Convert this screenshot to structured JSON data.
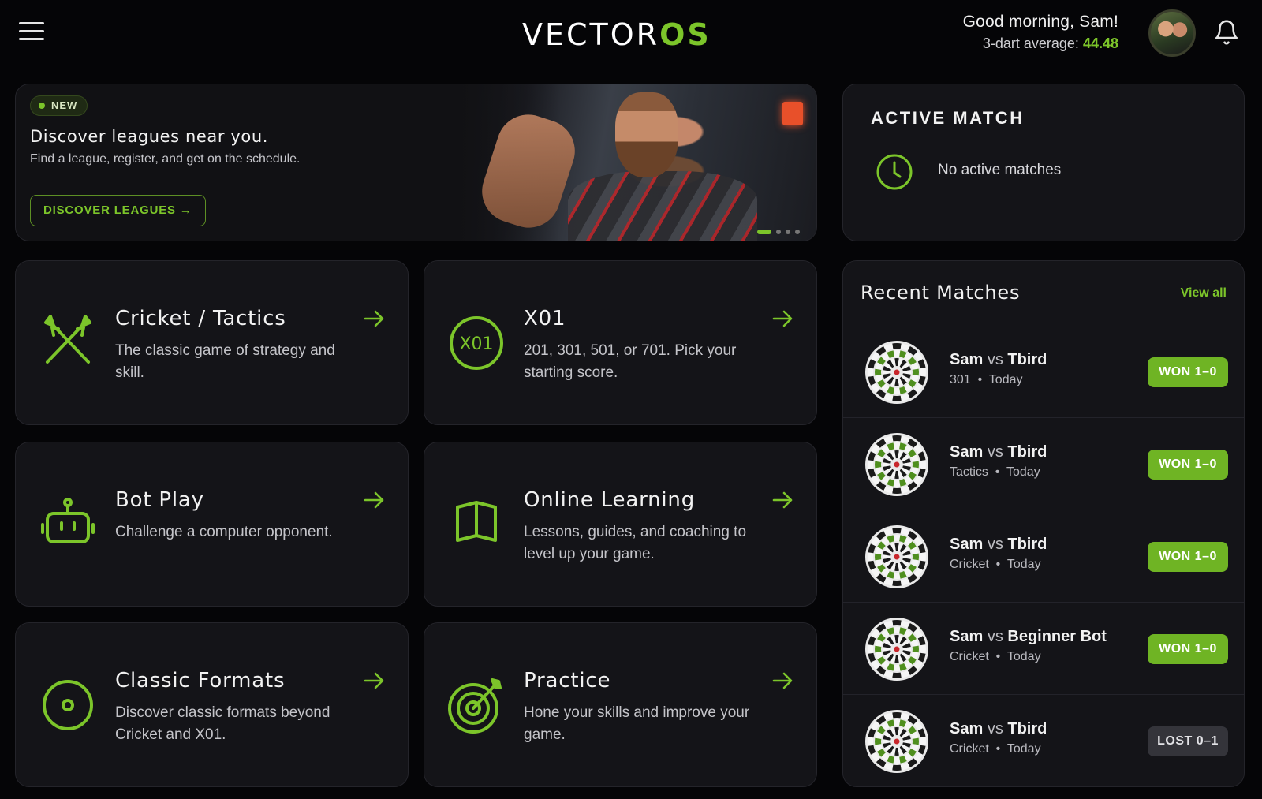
{
  "header": {
    "logo_left": "VECTOR",
    "logo_right": "OS",
    "greeting": "Good morning, Sam!",
    "avg_label": "3-dart average:",
    "avg_value": "44.48"
  },
  "hero": {
    "badge": "NEW",
    "title": "Discover leagues near you.",
    "subtitle": "Find a league, register, and get on the schedule.",
    "button": "DISCOVER LEAGUES →"
  },
  "active_match": {
    "title": "ACTIVE MATCH",
    "empty_text": "No active matches"
  },
  "tiles": [
    {
      "title": "Cricket / Tactics",
      "desc": "The classic game of strategy and skill.",
      "icon": "crossed-darts-icon"
    },
    {
      "title": "X01",
      "desc": "201, 301, 501, or 701. Pick your starting score.",
      "icon": "x01-icon",
      "icon_text": "X01"
    },
    {
      "title": "Bot Play",
      "desc": "Challenge a computer opponent.",
      "icon": "robot-icon"
    },
    {
      "title": "Online Learning",
      "desc": "Lessons, guides, and coaching to level up your game.",
      "icon": "book-icon"
    },
    {
      "title": "Classic Formats",
      "desc": "Discover classic formats beyond Cricket and X01.",
      "icon": "target-circle-icon"
    },
    {
      "title": "Practice",
      "desc": "Hone your skills and improve your game.",
      "icon": "dartboard-arrow-icon"
    }
  ],
  "recent": {
    "title": "Recent Matches",
    "view_all": "View all",
    "matches": [
      {
        "player": "Sam",
        "vs": "vs",
        "opponent": "Tbird",
        "format": "301",
        "when": "Today",
        "result": "WON 1–0",
        "won": true
      },
      {
        "player": "Sam",
        "vs": "vs",
        "opponent": "Tbird",
        "format": "Tactics",
        "when": "Today",
        "result": "WON 1–0",
        "won": true
      },
      {
        "player": "Sam",
        "vs": "vs",
        "opponent": "Tbird",
        "format": "Cricket",
        "when": "Today",
        "result": "WON 1–0",
        "won": true
      },
      {
        "player": "Sam",
        "vs": "vs",
        "opponent": "Beginner Bot",
        "format": "Cricket",
        "when": "Today",
        "result": "WON 1–0",
        "won": true
      },
      {
        "player": "Sam",
        "vs": "vs",
        "opponent": "Tbird",
        "format": "Cricket",
        "when": "Today",
        "result": "LOST 0–1",
        "won": false
      }
    ]
  },
  "colors": {
    "accent": "#7cc52a",
    "background": "#050507",
    "card": "#141418",
    "lost": "#34343a"
  }
}
